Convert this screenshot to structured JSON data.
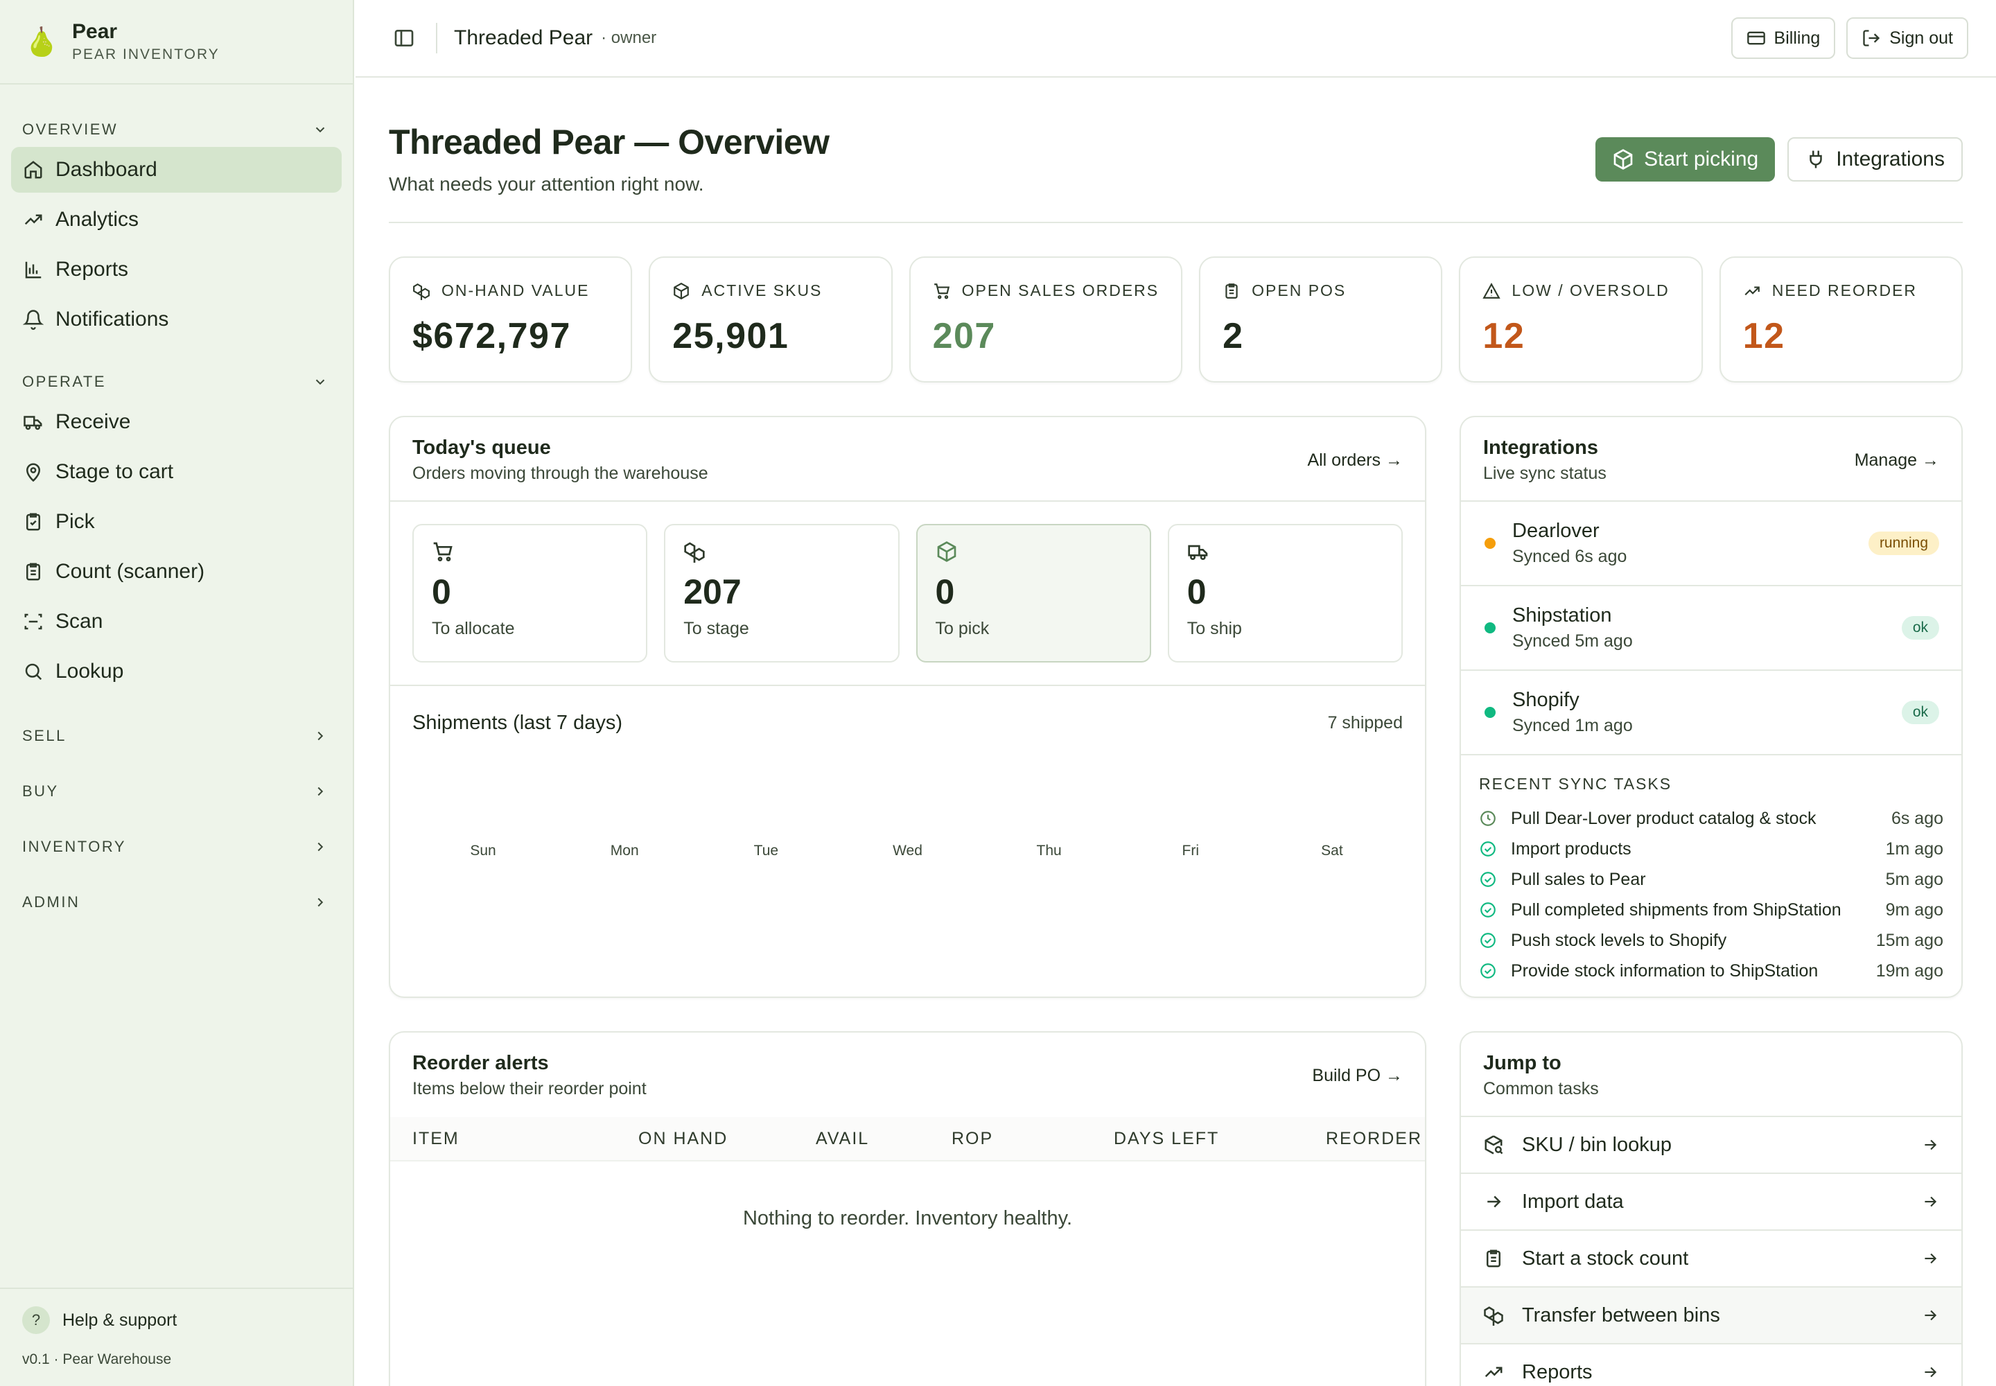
{
  "brand": {
    "name": "Pear",
    "subtitle": "PEAR INVENTORY",
    "logo_icon": "pear-icon"
  },
  "sidebar": {
    "sections": [
      {
        "label": "OVERVIEW",
        "expanded": true,
        "items": [
          {
            "label": "Dashboard",
            "icon": "home-icon",
            "active": true
          },
          {
            "label": "Analytics",
            "icon": "trend-icon"
          },
          {
            "label": "Reports",
            "icon": "bar-chart-icon"
          },
          {
            "label": "Notifications",
            "icon": "bell-icon"
          }
        ]
      },
      {
        "label": "OPERATE",
        "expanded": true,
        "items": [
          {
            "label": "Receive",
            "icon": "truck-icon"
          },
          {
            "label": "Stage to cart",
            "icon": "map-pin-icon"
          },
          {
            "label": "Pick",
            "icon": "clipboard-check-icon"
          },
          {
            "label": "Count (scanner)",
            "icon": "clipboard-icon"
          },
          {
            "label": "Scan",
            "icon": "scan-icon"
          },
          {
            "label": "Lookup",
            "icon": "search-icon"
          }
        ]
      },
      {
        "label": "SELL",
        "expanded": false
      },
      {
        "label": "BUY",
        "expanded": false
      },
      {
        "label": "INVENTORY",
        "expanded": false
      },
      {
        "label": "ADMIN",
        "expanded": false
      }
    ],
    "help_label": "Help & support",
    "help_badge": "?",
    "version": "v0.1 · Pear Warehouse"
  },
  "topbar": {
    "org": "Threaded Pear",
    "role": "· owner",
    "billing": "Billing",
    "signout": "Sign out"
  },
  "page": {
    "title": "Threaded Pear — Overview",
    "subtitle": "What needs your attention right now.",
    "primary_action": "Start picking",
    "secondary_action": "Integrations"
  },
  "kpis": [
    {
      "label": "ON-HAND VALUE",
      "value": "$672,797",
      "icon": "boxes-icon",
      "tone": "default"
    },
    {
      "label": "ACTIVE SKUS",
      "value": "25,901",
      "icon": "package-icon",
      "tone": "default"
    },
    {
      "label": "OPEN SALES ORDERS",
      "value": "207",
      "icon": "cart-icon",
      "tone": "green"
    },
    {
      "label": "OPEN POS",
      "value": "2",
      "icon": "clipboard-list-icon",
      "tone": "default"
    },
    {
      "label": "LOW / OVERSOLD",
      "value": "12",
      "icon": "alert-triangle-icon",
      "tone": "orange"
    },
    {
      "label": "NEED REORDER",
      "value": "12",
      "icon": "trend-icon",
      "tone": "orange"
    }
  ],
  "queue": {
    "title": "Today's queue",
    "subtitle": "Orders moving through the warehouse",
    "link": "All orders →",
    "items": [
      {
        "value": "0",
        "label": "To allocate",
        "icon": "cart-icon"
      },
      {
        "value": "207",
        "label": "To stage",
        "icon": "boxes-icon"
      },
      {
        "value": "0",
        "label": "To pick",
        "icon": "package-check-icon",
        "selected": true
      },
      {
        "value": "0",
        "label": "To ship",
        "icon": "truck-icon"
      }
    ],
    "shipments_title": "Shipments (last 7 days)",
    "shipments_count": "7 shipped"
  },
  "chart_data": {
    "type": "bar",
    "title": "Shipments (last 7 days)",
    "categories": [
      "Sun",
      "Mon",
      "Tue",
      "Wed",
      "Thu",
      "Fri",
      "Sat"
    ],
    "values": [
      0,
      0,
      0,
      0,
      0,
      0,
      0
    ],
    "xlabel": "",
    "ylabel": "",
    "grid": false
  },
  "integrations": {
    "title": "Integrations",
    "subtitle": "Live sync status",
    "link": "Manage →",
    "items": [
      {
        "name": "Dearlover",
        "sync": "Synced 6s ago",
        "status": "running",
        "color": "#f59e0b"
      },
      {
        "name": "Shipstation",
        "sync": "Synced 5m ago",
        "status": "ok",
        "color": "#10b981"
      },
      {
        "name": "Shopify",
        "sync": "Synced 1m ago",
        "status": "ok",
        "color": "#10b981"
      }
    ],
    "tasks_title": "RECENT SYNC TASKS",
    "tasks": [
      {
        "label": "Pull Dear-Lover product catalog & stock",
        "when": "6s ago",
        "icon": "clock-icon"
      },
      {
        "label": "Import products",
        "when": "1m ago",
        "icon": "check-circle-icon"
      },
      {
        "label": "Pull sales to Pear",
        "when": "5m ago",
        "icon": "check-circle-icon"
      },
      {
        "label": "Pull completed shipments from ShipStation",
        "when": "9m ago",
        "icon": "check-circle-icon"
      },
      {
        "label": "Push stock levels to Shopify",
        "when": "15m ago",
        "icon": "check-circle-icon"
      },
      {
        "label": "Provide stock information to ShipStation",
        "when": "19m ago",
        "icon": "check-circle-icon"
      }
    ]
  },
  "reorder": {
    "title": "Reorder alerts",
    "subtitle": "Items below their reorder point",
    "link": "Build PO →",
    "columns": [
      "ITEM",
      "ON HAND",
      "AVAIL",
      "ROP",
      "DAYS LEFT",
      "REORDER"
    ],
    "empty": "Nothing to reorder. Inventory healthy."
  },
  "jump": {
    "title": "Jump to",
    "subtitle": "Common tasks",
    "items": [
      {
        "label": "SKU / bin lookup",
        "icon": "package-search-icon"
      },
      {
        "label": "Import data",
        "icon": "arrow-right-icon"
      },
      {
        "label": "Start a stock count",
        "icon": "clipboard-list-icon"
      },
      {
        "label": "Transfer between bins",
        "icon": "boxes-icon"
      },
      {
        "label": "Reports",
        "icon": "trend-icon"
      }
    ]
  },
  "colors": {
    "accent": "#5b8a5a",
    "sidebar_bg": "#eef4ea",
    "active_item": "#d5e5cd",
    "warning": "#c2571a"
  }
}
